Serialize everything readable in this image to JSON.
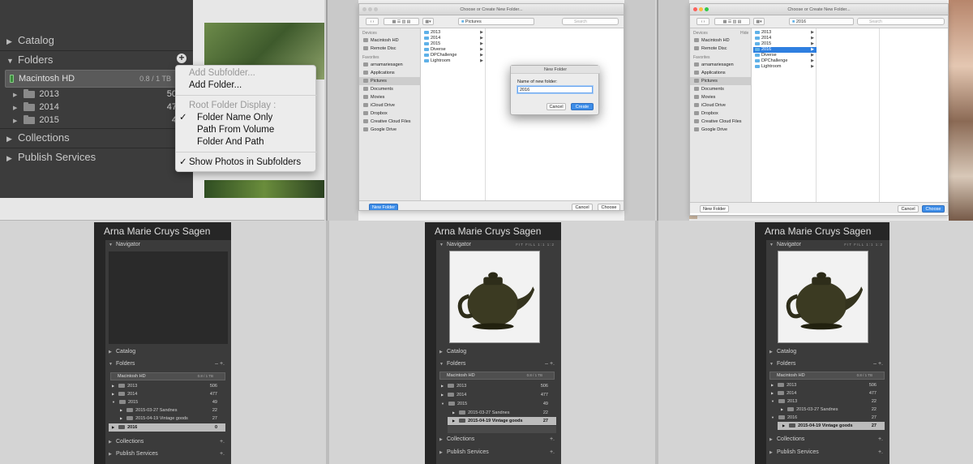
{
  "top_left": {
    "panels": {
      "catalog": "Catalog",
      "folders": "Folders",
      "collections": "Collections",
      "publish_services": "Publish Services"
    },
    "volume": {
      "name": "Macintosh HD",
      "size": "0.8 / 1 TB"
    },
    "folders": [
      {
        "name": "2013",
        "count": "50"
      },
      {
        "name": "2014",
        "count": "47"
      },
      {
        "name": "2015",
        "count": "4"
      }
    ],
    "add_icon": "plus-icon",
    "menu": {
      "add_subfolder": "Add Subfolder...",
      "add_folder": "Add Folder...",
      "root_display": "Root Folder Display :",
      "check_mark": "✓",
      "name_only": "Folder Name Only",
      "path_from_volume": "Path From Volume",
      "folder_and_path": "Folder And Path",
      "show_sub": "Show Photos in Subfolders"
    }
  },
  "dialog_common": {
    "title": "Choose or Create New Folder...",
    "search_placeholder": "Search",
    "devices_heading": "Devices",
    "favorites_heading": "Favorites",
    "hide": "Hide",
    "devices": [
      "Macintosh HD",
      "Remote Disc"
    ],
    "favorites": [
      "arnamariesagen",
      "Applications",
      "Pictures",
      "Documents",
      "Movies",
      "iCloud Drive",
      "Dropbox",
      "Creative Cloud Files",
      "Google Drive"
    ],
    "new_folder_btn": "New Folder",
    "cancel_btn": "Cancel",
    "choose_btn": "Choose"
  },
  "dialog_mid": {
    "path": "Pictures",
    "files": [
      "2013",
      "2014",
      "2015",
      "Diverse",
      "DPChallenge",
      "Lightroom"
    ]
  },
  "dialog_right": {
    "path": "2016",
    "files": [
      "2013",
      "2014",
      "2015",
      "2016",
      "Diverse",
      "DPChallenge",
      "Lightroom"
    ]
  },
  "new_folder_sheet": {
    "title": "New Folder",
    "label": "Name of new folder:",
    "value": "2016",
    "cancel": "Cancel",
    "create": "Create"
  },
  "lr_bottom": {
    "user_name": "Arna Marie Cruys Sagen",
    "navigator": "Navigator",
    "nav_options": "FIT  FILL  1:1  1:2",
    "catalog": "Catalog",
    "folders": "Folders",
    "folders_actions": "–  +.",
    "collections": "Collections",
    "publish_services": "Publish Services",
    "plus": "+.",
    "volume": "Macintosh HD",
    "volume_size": "0.8 / 1 TB",
    "left_rows": [
      {
        "name": "2013",
        "count": "506"
      },
      {
        "name": "2014",
        "count": "477"
      },
      {
        "name": "2015",
        "count": "49"
      },
      {
        "name": "2015-03-27 Sandnes",
        "count": "22"
      },
      {
        "name": "2015-04-19 Vintage goods",
        "count": "27"
      },
      {
        "name": "2016",
        "count": "0"
      }
    ],
    "mid_rows": [
      {
        "name": "2013",
        "count": "506"
      },
      {
        "name": "2014",
        "count": "477"
      },
      {
        "name": "2015",
        "count": "49"
      },
      {
        "name": "2015-03-27 Sandnes",
        "count": "22"
      },
      {
        "name": "2015-04-19 Vintage goods",
        "count": "27"
      }
    ],
    "right_rows": [
      {
        "name": "2013",
        "count": "506"
      },
      {
        "name": "2014",
        "count": "477"
      },
      {
        "name": "2013",
        "count": "22"
      },
      {
        "name": "2015-03-27 Sandnes",
        "count": "22"
      },
      {
        "name": "2016",
        "count": "27"
      },
      {
        "name": "2015-04-19 Vintage goods",
        "count": "27"
      }
    ]
  }
}
